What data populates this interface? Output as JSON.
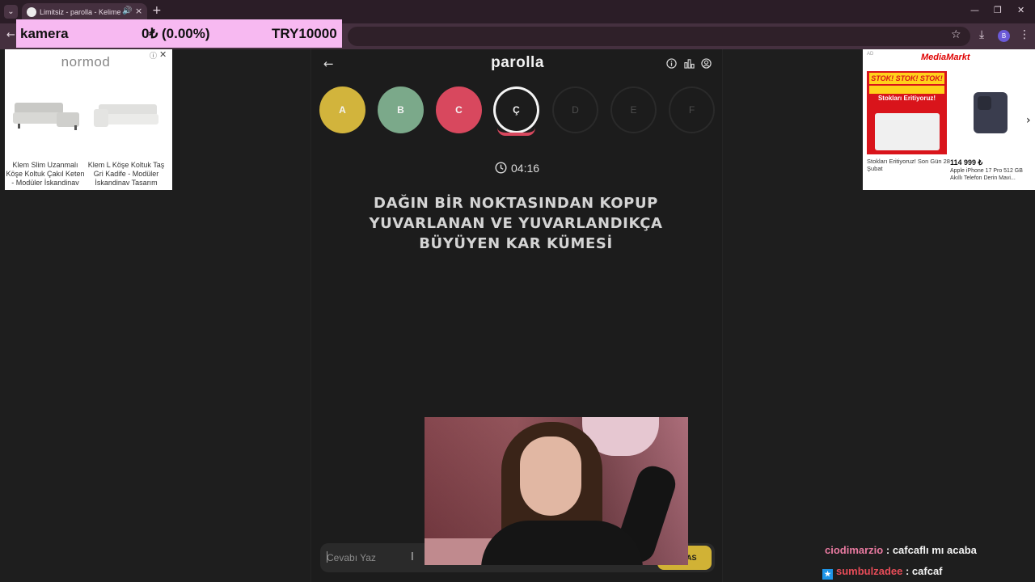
{
  "browser": {
    "tab_title": "Limitsiz - parolla - Kelime o",
    "tab_icons": [
      "chevron-down-icon",
      "audio-icon",
      "close-icon",
      "plus-icon"
    ],
    "profile_initial": "B"
  },
  "ticker": {
    "label": "kamera",
    "value": "0₺ (0.00%)",
    "goal": "TRY10000",
    "bg_color": "#f7b9f1"
  },
  "ad_left": {
    "brand": "normod",
    "products": [
      {
        "name": "Klem Slim Uzanmalı Köşe Koltuk Çakıl Keten - Modüler İskandinav"
      },
      {
        "name": "Klem L Köşe Koltuk Taş Gri Kadife - Modüler İskandinav Tasarım"
      }
    ]
  },
  "ad_right": {
    "ad_label": "AD",
    "brand": "MediaMarkt",
    "promo_heading": "STOK! STOK! STOK!",
    "promo_title": "Stokları Eritiyoruz!",
    "promo_caption": "Stokları Eritiyoruz! Son Gün 28 Şubat",
    "price": "114 999 ₺",
    "product_caption": "Apple iPhone 17 Pro 512 GB Akıllı Telefon Derin Mavi..."
  },
  "game": {
    "logo": "parolla",
    "letters": [
      {
        "label": "A",
        "state": "correct",
        "color": "#d2b43c"
      },
      {
        "label": "B",
        "state": "correct",
        "color": "#7ba98a"
      },
      {
        "label": "C",
        "state": "wrong",
        "color": "#d8485e"
      },
      {
        "label": "Ç",
        "state": "active",
        "color": "#1c1c1c"
      },
      {
        "label": "D",
        "state": "pending",
        "color": "#1c1c1c"
      },
      {
        "label": "E",
        "state": "pending",
        "color": "#1c1c1c"
      },
      {
        "label": "F",
        "state": "pending",
        "color": "#1c1c1c"
      }
    ],
    "timer": "04:16",
    "question": "DAĞIN BİR NOKTASINDAN KOPUP YUVARLANAN VE YUVARLANDIKÇA BÜYÜYEN KAR KÜMESİ",
    "answer_placeholder": "Cevabı Yaz",
    "answer_value": "",
    "submit_label": "AS",
    "accent_color": "#d1b235"
  },
  "chat": [
    {
      "user": "ciodimarzio",
      "message": ": cafcaflı mı acaba"
    },
    {
      "user": "sumbulzadee",
      "message": ": cafcaf"
    }
  ]
}
